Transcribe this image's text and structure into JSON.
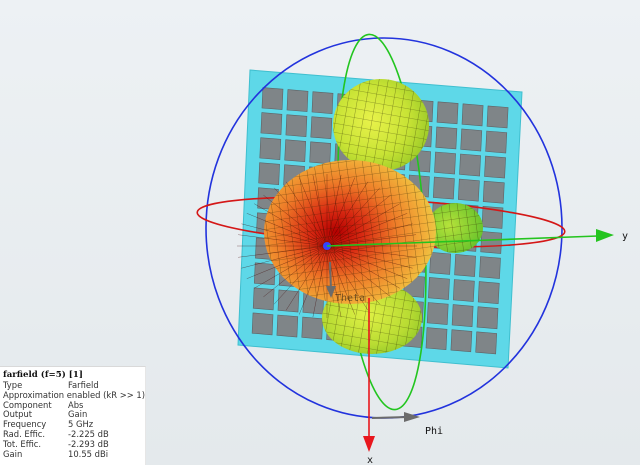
{
  "axes": {
    "x_label": "x",
    "y_label": "y",
    "phi_label": "Phi",
    "theta_label": "Theta"
  },
  "colors": {
    "background": "#e9edf0",
    "substrate": "#5ed8e8",
    "patch": "#7f8588",
    "sphere_ring": "#2233dd",
    "equator_ring": "#d41717",
    "meridian_ring": "#22c51f",
    "x_axis": "#e8171d",
    "y_axis": "#24c41f",
    "phi_arrow": "#6b6b6b"
  },
  "info_panel": {
    "title": "farfield (f=5) [1]",
    "rows": [
      {
        "key": "Type",
        "value": "Farfield"
      },
      {
        "key": "Approximation",
        "value": "enabled (kR >> 1)"
      },
      {
        "key": "Component",
        "value": "Abs"
      },
      {
        "key": "Output",
        "value": "Gain"
      },
      {
        "key": "Frequency",
        "value": "5 GHz"
      },
      {
        "key": "Rad. Effic.",
        "value": "-2.225 dB"
      },
      {
        "key": "Tot. Effic.",
        "value": "-2.293 dB"
      },
      {
        "key": "Gain",
        "value": "10.55 dBi"
      }
    ]
  }
}
